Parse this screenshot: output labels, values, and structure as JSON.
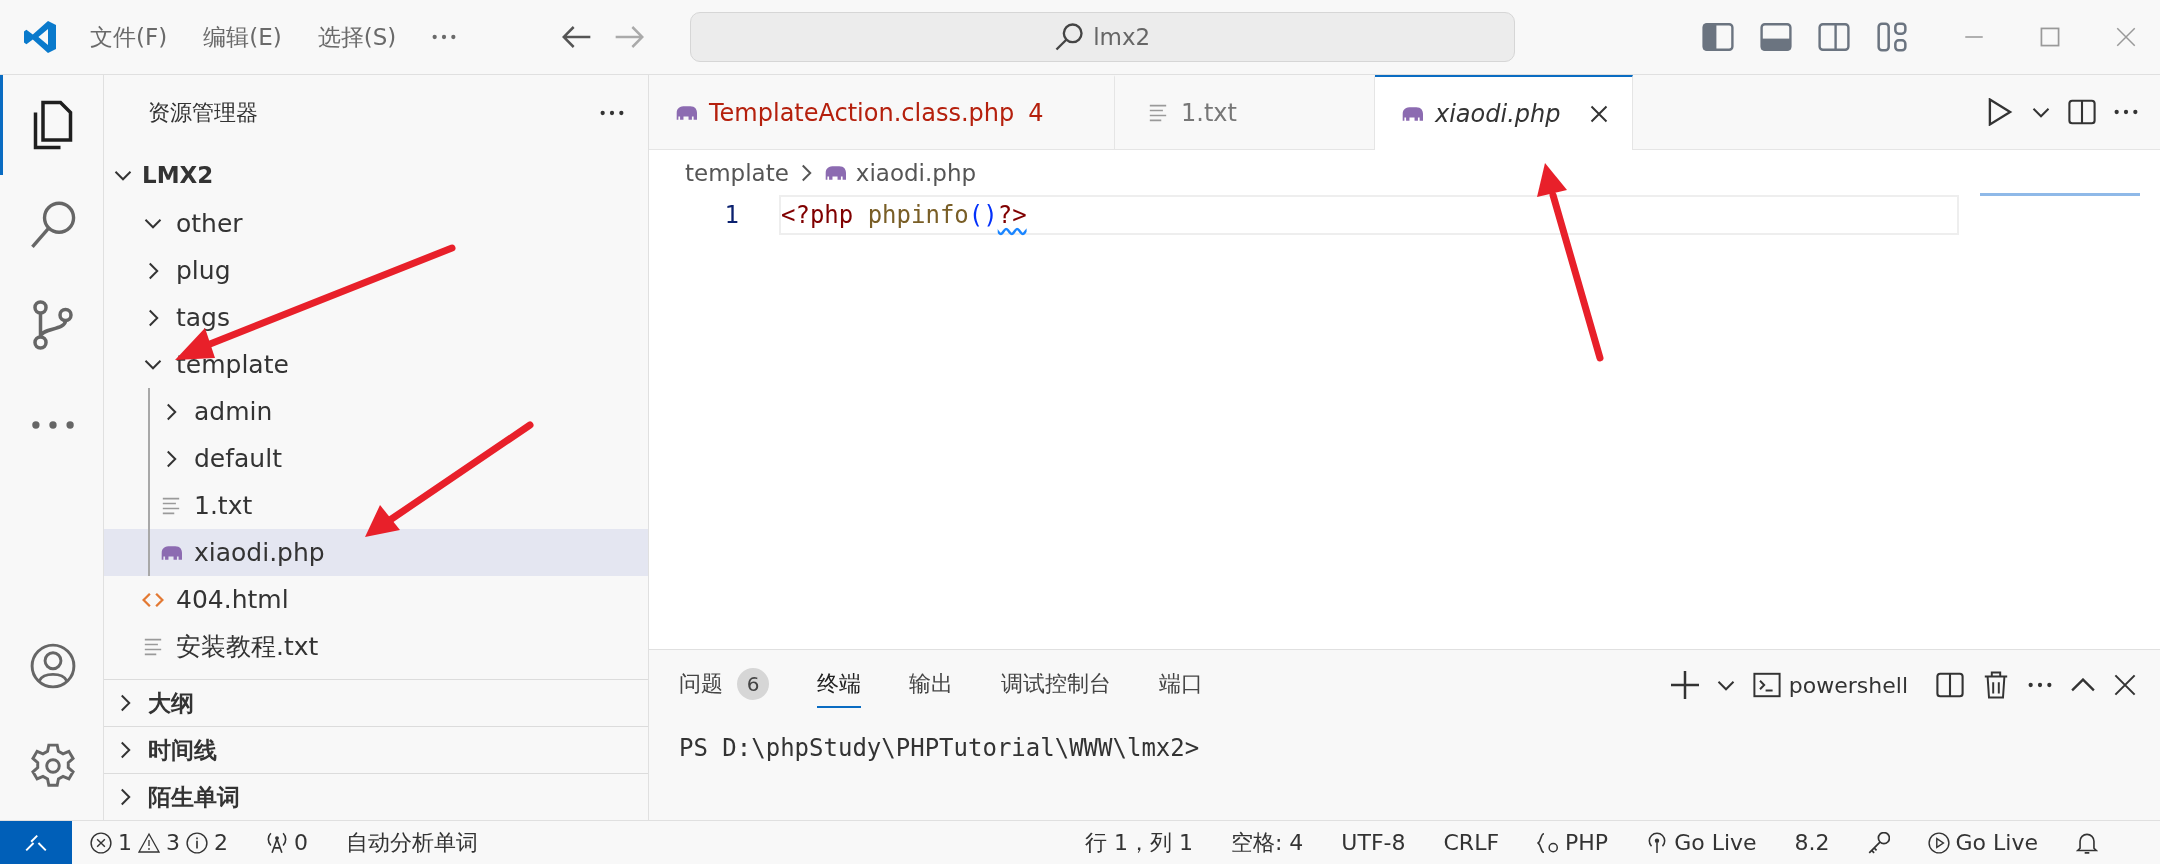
{
  "title_bar": {
    "menu": [
      "文件(F)",
      "编辑(E)",
      "选择(S)"
    ],
    "search": {
      "value": "lmx2"
    }
  },
  "activity_bar": [
    {
      "kind": "explorer",
      "selected": true
    },
    {
      "kind": "search",
      "selected": false
    },
    {
      "kind": "source-control",
      "selected": false
    },
    {
      "kind": "more",
      "selected": false
    }
  ],
  "explorer": {
    "title": "资源管理器",
    "root": {
      "label": "LMX2",
      "expanded": true,
      "children": [
        {
          "label": "other",
          "kind": "folder",
          "expanded": true,
          "selected": false
        },
        {
          "label": "plug",
          "kind": "folder",
          "expanded": false,
          "selected": false
        },
        {
          "label": "tags",
          "kind": "folder",
          "expanded": false,
          "selected": false
        },
        {
          "label": "template",
          "kind": "folder",
          "expanded": true,
          "selected": false,
          "children": [
            {
              "label": "admin",
              "kind": "folder",
              "expanded": false,
              "selected": false
            },
            {
              "label": "default",
              "kind": "folder",
              "expanded": false,
              "selected": false
            },
            {
              "label": "1.txt",
              "kind": "text",
              "selected": false
            },
            {
              "label": "xiaodi.php",
              "kind": "php",
              "selected": true
            }
          ]
        },
        {
          "label": "404.html",
          "kind": "html",
          "selected": false
        },
        {
          "label": "安装教程.txt",
          "kind": "text",
          "selected": false
        }
      ]
    }
  },
  "sections": [
    {
      "label": "大纲",
      "expanded": false
    },
    {
      "label": "时间线",
      "expanded": false
    },
    {
      "label": "陌生单词",
      "expanded": false
    }
  ],
  "tabs": [
    {
      "label": "TemplateAction.class.php",
      "kind": "php",
      "problems": "4",
      "error": true,
      "preview": false,
      "selected": false
    },
    {
      "label": "1.txt",
      "kind": "text",
      "error": false,
      "preview": false,
      "selected": false
    },
    {
      "label": "xiaodi.php",
      "kind": "php",
      "error": false,
      "preview": true,
      "selected": true
    }
  ],
  "breadcrumb": [
    {
      "label": "template",
      "kind": "folder"
    },
    {
      "label": "xiaodi.php",
      "kind": "php"
    }
  ],
  "editor": {
    "lines": [
      {
        "number": "1",
        "tokens": [
          {
            "text": "<?php",
            "kind": "tag",
            "squiggle": false
          },
          {
            "text": "phpinfo",
            "kind": "function",
            "squiggle": false
          },
          {
            "text": "()",
            "kind": "paren",
            "squiggle": false
          },
          {
            "text": "?>",
            "kind": "tag",
            "squiggle": true
          }
        ]
      }
    ]
  },
  "panel": {
    "tabs": [
      {
        "label": "问题",
        "badge": "6",
        "selected": false
      },
      {
        "label": "终端",
        "selected": true
      },
      {
        "label": "输出",
        "selected": false
      },
      {
        "label": "调试控制台",
        "selected": false
      },
      {
        "label": "端口",
        "selected": false
      }
    ],
    "terminal_name": "powershell",
    "terminal_lines": [
      "PS D:\\phpStudy\\PHPTutorial\\WWW\\lmx2>"
    ]
  },
  "status_bar": {
    "errors": "1",
    "warnings": "3",
    "infos": "2",
    "ports": "0",
    "left_text": "自动分析单词",
    "right_items": [
      {
        "kind": "text",
        "text": "行 1，列 1"
      },
      {
        "kind": "text",
        "text": "空格: 4"
      },
      {
        "kind": "text",
        "text": "UTF-8"
      },
      {
        "kind": "text",
        "text": "CRLF"
      },
      {
        "kind": "language",
        "text": "PHP"
      },
      {
        "kind": "broadcast",
        "text": "Go Live"
      },
      {
        "kind": "text",
        "text": "8.2"
      },
      {
        "kind": "key"
      },
      {
        "kind": "play",
        "text": "Go Live"
      },
      {
        "kind": "bell"
      }
    ]
  }
}
